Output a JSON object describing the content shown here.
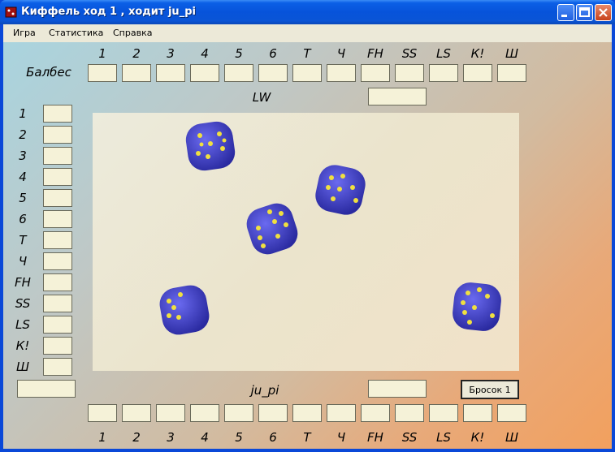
{
  "window": {
    "title": "Киффель ход 1 , ходит ju_pi"
  },
  "menu": [
    "Игра",
    "Статистика",
    "Справка"
  ],
  "categories": [
    "1",
    "2",
    "3",
    "4",
    "5",
    "6",
    "Т",
    "Ч",
    "FH",
    "SS",
    "LS",
    "К!",
    "Ш"
  ],
  "players": {
    "top": "Балбес",
    "top_total_label": "LW",
    "bottom": "ju_pi"
  },
  "roll_button": "Бросок 1",
  "dice": [
    {
      "value": 5
    },
    {
      "value": 6
    },
    {
      "value": 5
    },
    {
      "value": 5
    },
    {
      "value": 5
    }
  ],
  "colors": {
    "die": "#4a4ad8",
    "pip": "#f0e040",
    "score_box": "#f5f2d8"
  }
}
